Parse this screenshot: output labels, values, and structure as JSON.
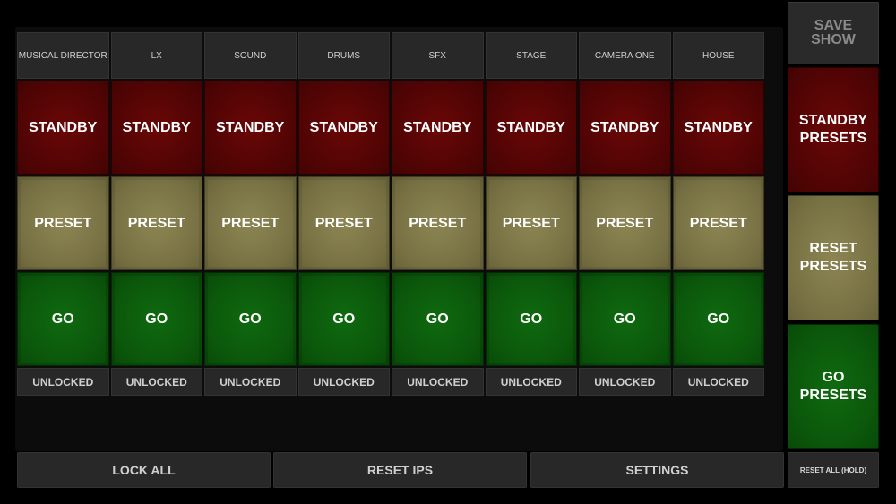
{
  "channels": [
    {
      "name": "MUSICAL DIRECTOR",
      "standby": "STANDBY",
      "preset": "PRESET",
      "go": "GO",
      "lock": "UNLOCKED"
    },
    {
      "name": "LX",
      "standby": "STANDBY",
      "preset": "PRESET",
      "go": "GO",
      "lock": "UNLOCKED"
    },
    {
      "name": "SOUND",
      "standby": "STANDBY",
      "preset": "PRESET",
      "go": "GO",
      "lock": "UNLOCKED"
    },
    {
      "name": "DRUMS",
      "standby": "STANDBY",
      "preset": "PRESET",
      "go": "GO",
      "lock": "UNLOCKED"
    },
    {
      "name": "SFX",
      "standby": "STANDBY",
      "preset": "PRESET",
      "go": "GO",
      "lock": "UNLOCKED"
    },
    {
      "name": "STAGE",
      "standby": "STANDBY",
      "preset": "PRESET",
      "go": "GO",
      "lock": "UNLOCKED"
    },
    {
      "name": "CAMERA ONE",
      "standby": "STANDBY",
      "preset": "PRESET",
      "go": "GO",
      "lock": "UNLOCKED"
    },
    {
      "name": "HOUSE",
      "standby": "STANDBY",
      "preset": "PRESET",
      "go": "GO",
      "lock": "UNLOCKED"
    }
  ],
  "side": {
    "save_line1": "SAVE",
    "save_line2": "SHOW",
    "standby_line1": "STANDBY",
    "standby_line2": "PRESETS",
    "reset_line1": "RESET",
    "reset_line2": "PRESETS",
    "go_line1": "GO",
    "go_line2": "PRESETS",
    "reset_all": "RESET ALL (HOLD)"
  },
  "bottom": {
    "lock_all": "LOCK ALL",
    "reset_ips": "RESET IPS",
    "settings": "SETTINGS"
  },
  "colors": {
    "standby": "#500404",
    "preset": "#777043",
    "go": "#0b560b",
    "neutral": "#282828"
  }
}
